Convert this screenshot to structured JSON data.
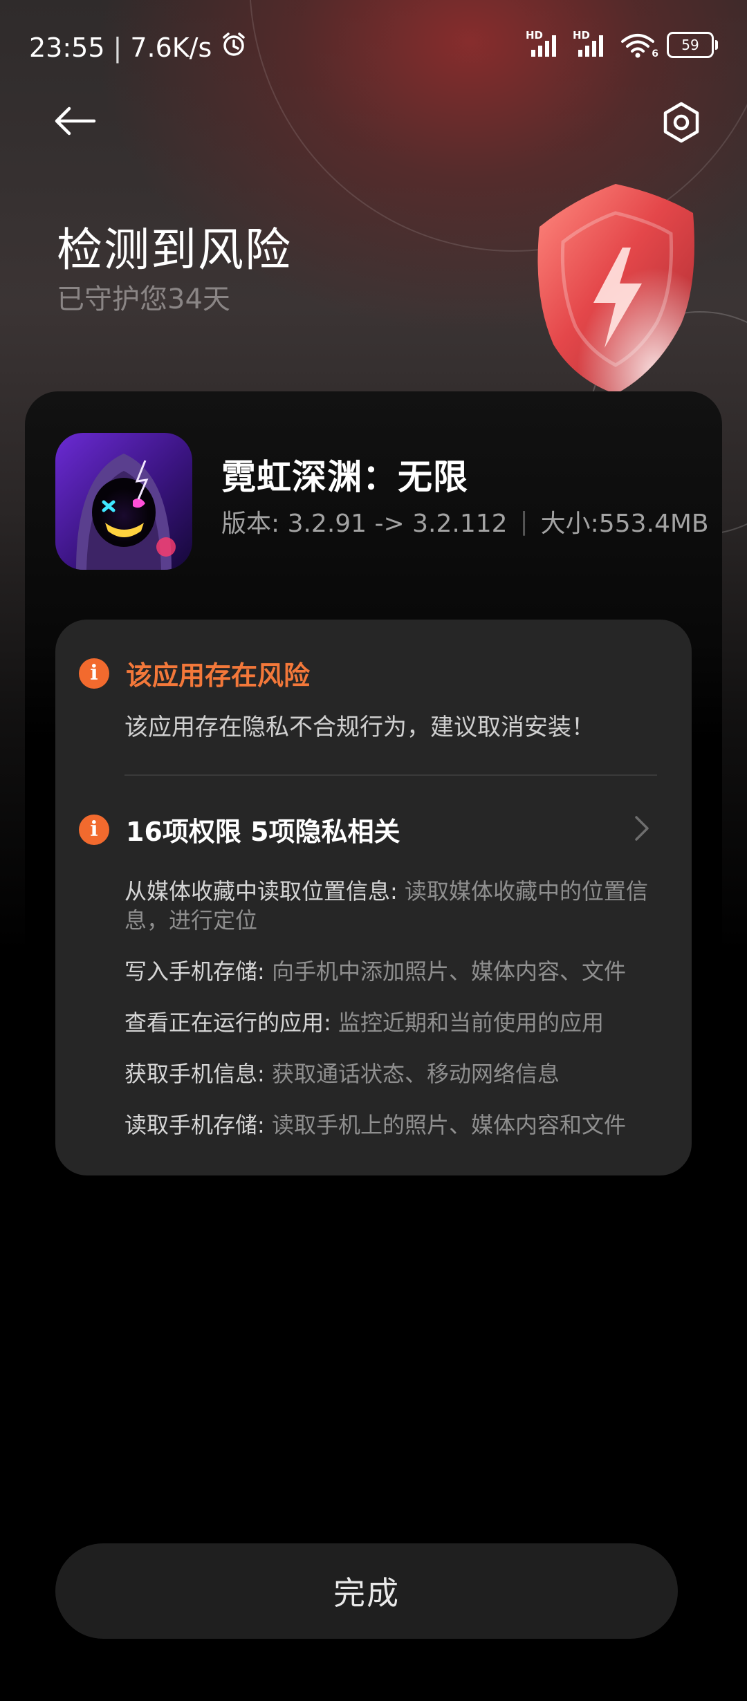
{
  "status_bar": {
    "time": "23:55",
    "net_speed": "7.6K/s",
    "battery": "59",
    "signal_labels": [
      "HD",
      "HD"
    ],
    "wifi_badge": "6"
  },
  "header": {
    "title": "检测到风险",
    "subtitle": "已守护您34天"
  },
  "app": {
    "name": "霓虹深渊：无限",
    "version": "版本: 3.2.91 -> 3.2.112",
    "size": "大小:553.4MB"
  },
  "risk": {
    "title": "该应用存在风险",
    "description": "该应用存在隐私不合规行为，建议取消安装！"
  },
  "permissions": {
    "title": "16项权限 5项隐私相关",
    "items": [
      {
        "name": "从媒体收藏中读取位置信息:",
        "detail": " 读取媒体收藏中的位置信息，进行定位"
      },
      {
        "name": "写入手机存储:",
        "detail": " 向手机中添加照片、媒体内容、文件"
      },
      {
        "name": "查看正在运行的应用:",
        "detail": " 监控近期和当前使用的应用"
      },
      {
        "name": "获取手机信息:",
        "detail": " 获取通话状态、移动网络信息"
      },
      {
        "name": "读取手机存储:",
        "detail": " 读取手机上的照片、媒体内容和文件"
      }
    ]
  },
  "actions": {
    "done_label": "完成"
  },
  "colors": {
    "warning": "#f26a2e",
    "shield": "#e4474a",
    "panel": "#262626"
  },
  "icons": {
    "back": "arrow-left-icon",
    "settings": "hexagon-gear-icon",
    "warning": "info-circle-icon",
    "chevron": "chevron-right-icon"
  }
}
